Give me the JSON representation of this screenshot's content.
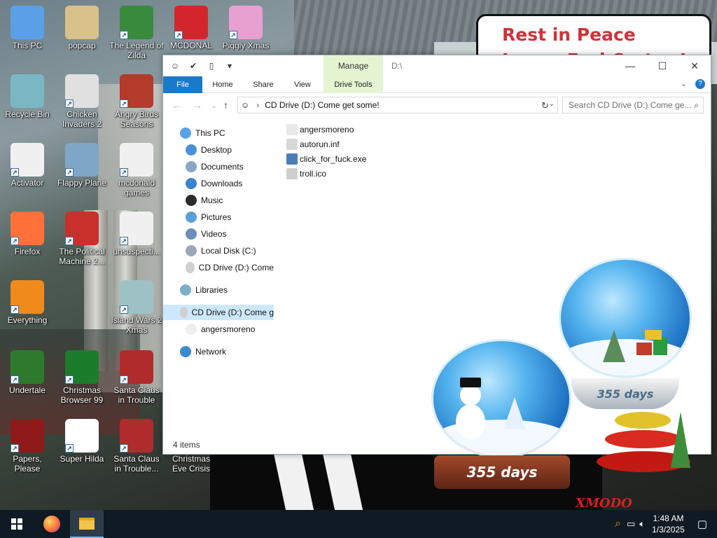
{
  "desktop": {
    "sign": {
      "line1": "Rest in Peace",
      "line2": "James Earl Carter Jr."
    },
    "icons": [
      {
        "label": "This PC",
        "icon": "computer-icon",
        "color": "#5aa0e8"
      },
      {
        "label": "popcap",
        "icon": "folder-icon",
        "color": "#d9c28a"
      },
      {
        "label": "The Legend of Zilda",
        "icon": "game-icon",
        "color": "#3a8a3e"
      },
      {
        "label": "MCDONAL",
        "icon": "mcdonalds-icon",
        "color": "#d2262c"
      },
      {
        "label": "Piggly Xmas",
        "icon": "pig-icon",
        "color": "#e8a0d0"
      },
      {
        "label": "Recycle Bin",
        "icon": "recycle-bin-icon",
        "color": "#7ab7c4"
      },
      {
        "label": "Chicken Invaders 2",
        "icon": "chicken-icon",
        "color": "#e0e0e0"
      },
      {
        "label": "Angry Birds Seasons",
        "icon": "angry-bird-icon",
        "color": "#b43a2a"
      },
      {
        "label": "Activator",
        "icon": "blank-file-icon",
        "color": "#f0f0f0"
      },
      {
        "label": "Flappy Plane",
        "icon": "plane-icon",
        "color": "#7fa6c6"
      },
      {
        "label": "mcdonald games",
        "icon": "blank-file-icon",
        "color": "#f0f0f0"
      },
      {
        "label": "Firefox",
        "icon": "firefox-icon",
        "color": "#ff7139"
      },
      {
        "label": "The Political Machine 2...",
        "icon": "political-icon",
        "color": "#c9302c"
      },
      {
        "label": "unsuspecti...",
        "icon": "blank-file-icon",
        "color": "#f0f0f0"
      },
      {
        "label": "Everything",
        "icon": "magnifier-icon",
        "color": "#f08a1d"
      },
      {
        "label": "Island Wars 2 Xmas",
        "icon": "island-icon",
        "color": "#9ec2c4"
      },
      {
        "label": "Undertale",
        "icon": "undertale-icon",
        "color": "#2d7a2d"
      },
      {
        "label": "Christmas Browser 99",
        "icon": "xmas-tree-icon",
        "color": "#1b7d2b"
      },
      {
        "label": "Santa Claus in Trouble",
        "icon": "santa-icon",
        "color": "#b02b2b"
      },
      {
        "label": "Papers, Please",
        "icon": "papers-icon",
        "color": "#8e1a1a"
      },
      {
        "label": "Super Hilda",
        "icon": "dog-icon",
        "color": "#ffffff"
      },
      {
        "label": "Santa Claus in Trouble... A...",
        "icon": "santa-icon",
        "color": "#b02b2b"
      },
      {
        "label": "Christmas Eve Crisis",
        "icon": "none",
        "color": "transparent"
      }
    ],
    "globe1_text": "355 days",
    "globe2_text": "355 days",
    "xmas_logo": "XMODO"
  },
  "explorer": {
    "title_path": "D:\\",
    "manage_tab": "Manage",
    "window_buttons": {
      "minimize": "—",
      "maximize": "☐",
      "close": "✕"
    },
    "tabs": [
      "File",
      "Home",
      "Share",
      "View",
      "Drive Tools"
    ],
    "address": "CD Drive (D:) Come get some!",
    "search_placeholder": "Search CD Drive (D:) Come ge...",
    "nav_items": [
      {
        "label": "This PC",
        "icon": "computer-icon"
      },
      {
        "label": "Desktop",
        "icon": "desktop-icon"
      },
      {
        "label": "Documents",
        "icon": "documents-icon"
      },
      {
        "label": "Downloads",
        "icon": "downloads-icon"
      },
      {
        "label": "Music",
        "icon": "music-icon"
      },
      {
        "label": "Pictures",
        "icon": "pictures-icon"
      },
      {
        "label": "Videos",
        "icon": "videos-icon"
      },
      {
        "label": "Local Disk (C:)",
        "icon": "disk-icon"
      },
      {
        "label": "CD Drive (D:) Come",
        "icon": "troll-drive-icon"
      },
      {
        "label": "Libraries",
        "icon": "libraries-icon"
      },
      {
        "label": "CD Drive (D:) Come g",
        "icon": "troll-drive-icon"
      },
      {
        "label": "angersmoreno",
        "icon": "file-icon"
      },
      {
        "label": "Network",
        "icon": "network-icon"
      }
    ],
    "files": [
      {
        "name": "angersmoreno",
        "icon": "file-icon"
      },
      {
        "name": "autorun.inf",
        "icon": "settings-file-icon"
      },
      {
        "name": "click_for_fuck.exe",
        "icon": "exe-icon"
      },
      {
        "name": "troll.ico",
        "icon": "troll-face-icon"
      }
    ],
    "status": "4 items"
  },
  "taskbar": {
    "time": "1:48 AM",
    "date": "1/3/2025"
  },
  "colors": {
    "accent": "#1979ca",
    "manage_green": "#e5f5d2",
    "taskbar": "#0f1a24",
    "sign_red": "#d1323a"
  }
}
